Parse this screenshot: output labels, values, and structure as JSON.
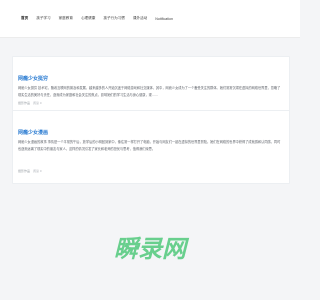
{
  "nav": {
    "items": [
      {
        "label": "首页"
      },
      {
        "label": "孩子学习"
      },
      {
        "label": "家庭教育"
      },
      {
        "label": "心理健康"
      },
      {
        "label": "孩子行为习惯"
      },
      {
        "label": "课外活动"
      },
      {
        "label": "Notification"
      }
    ]
  },
  "cards": [
    {
      "title": "网瘾少女挺穷",
      "desc": "网瘾少女挺穷 技术宅，随着互联网的普及和发展，越来越多的人开始沉迷于网络游戏和社交媒体，其中，网瘾少女成为了一个备受关注的群体。她们常常沉溺在虚拟的网络世界里，忽略了现实生活的美好与责任，逐渐成为家庭和社会关注的焦点，影响她们的学习生活与身心健康，现……",
      "meta": "摄影作品",
      "views": "阅读 0"
    },
    {
      "title": "网瘾少女漫画",
      "desc": "网瘾少女漫画的故事 事情是一个平常的午后，放学后的小明回到家中，像往常一样打开了电脑，开始与网友们一起在虚拟的世界里冒险。她们在网络的世界中获得了成就感和认同感，同时也逐渐远离了现实中的朋友与家人，这样的情况引发了家长和老师的担忧与思考，值得我们深思。",
      "meta": "摄影作品",
      "views": "阅读 0"
    }
  ],
  "watermark": {
    "text": "瞬录网",
    "color": "#39c26a"
  }
}
